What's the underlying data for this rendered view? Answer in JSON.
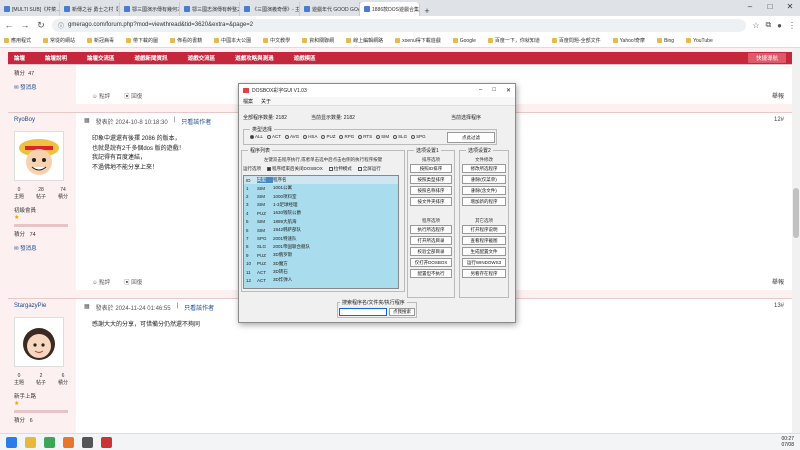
{
  "browser": {
    "tabs": [
      {
        "label": "[MULTI SUB]《芹菜…畢竟歡迎"
      },
      {
        "label": "新傳之谷 勇士之村【藍圖更新】"
      },
      {
        "label": "鄂三國演示傳有幾何三國94拜…"
      },
      {
        "label": "鄂三國志演傳有幹整之戰_固定"
      },
      {
        "label": "《三國演義奇傳》- 主題動畫("
      },
      {
        "label": "遊戲年代 GOOD GOAL - 遊戲 遊戲"
      },
      {
        "label": "1886款DOS遊戲合集-遊戲年代…"
      }
    ],
    "active_tab": 6,
    "url": "gmerago.com/forum.php?mod=viewthread&tid=3620&extra=&page=2"
  },
  "bookmarks": [
    "應用程式",
    "常從的網站",
    "新冠病毒",
    "帶下載的圖",
    "佈看的書籍",
    "中國本大公園",
    "中文教學",
    "資和關聯網",
    "線上編輯網路",
    "xoenu得下載遊戲",
    "Google",
    "百度一下，你就知道",
    "百度問題-全部文件",
    "Yahoo!奇摩",
    "Bing",
    "YouTube"
  ],
  "forum": {
    "nav": [
      "論壇",
      "論壇說明",
      "論壇交流區",
      "遊戲新聞資訊",
      "遊戲交流區",
      "遊戲攻略與測過",
      "遊戲模區"
    ],
    "quick_nav": "快捷導航",
    "post0": {
      "label_points": "積分",
      "points": "47",
      "send_msg": "發消息",
      "like": "點評",
      "reply": "回復",
      "report": "舉報"
    },
    "post1": {
      "user": "RyoBoy",
      "meta": "發表於 2024-10-8 10:18:30",
      "author_only": "只看該作者",
      "floor": "12#",
      "lines": [
        "印象中還還有後擇 2086 的版本，",
        "也就是說有2千多個dos 版的遊戲！",
        "我記得有百度連結，",
        "不過佛地不能分享上來！"
      ],
      "stats": [
        {
          "n": "0",
          "l": "主題"
        },
        {
          "n": "28",
          "l": "帖子"
        },
        {
          "n": "74",
          "l": "積分"
        }
      ],
      "rank": "初級會員",
      "points_label": "積分",
      "points": "74",
      "send_msg": "發消息",
      "like": "點評",
      "reply": "回復",
      "report": "舉報"
    },
    "post2": {
      "user": "StargazyPie",
      "meta": "發表於 2024-11-24 01:46:55",
      "author_only": "只看該作者",
      "floor": "13#",
      "text": "感謝大大的分享，可惜備分仍然還不夠同",
      "stats": [
        {
          "n": "0",
          "l": "主題"
        },
        {
          "n": "2",
          "l": "帖子"
        },
        {
          "n": "6",
          "l": "積分"
        }
      ],
      "rank": "新手上路",
      "points_label": "積分",
      "points": "6"
    }
  },
  "app": {
    "title": "DOSBOX彩宇GUI V1.03",
    "menu": [
      "檔案",
      "关于"
    ],
    "total_label": "全部程序数量:",
    "total": "2182",
    "current_label": "当前显示数量:",
    "current": "2182",
    "selected_label": "当前选择程序",
    "type_group": "类型选择",
    "types": [
      "ALL",
      "ACT",
      "AVG",
      "HSA",
      "PUZ",
      "RPG",
      "RTS",
      "SIM",
      "SLG",
      "SPG"
    ],
    "selected_type": "ALL",
    "click_filter": "点此过滤",
    "list_group": "程序列表",
    "hint": "左键双击程序执行,或者单击选中后点击右侧的执行程序按键",
    "opt_label": "运行选项",
    "options": [
      {
        "label": "程序结束后关闭DOSBOX",
        "on": true
      },
      {
        "label": "拉伸模式",
        "on": false
      },
      {
        "label": "全屏运行",
        "on": false
      }
    ],
    "cols": [
      "ID",
      "类型",
      "程序名"
    ],
    "rows": [
      [
        "1",
        "SIM",
        "1001公寓"
      ],
      [
        "2",
        "SIM",
        "1000项料室"
      ],
      [
        "3",
        "SIM",
        "1-3足球经理"
      ],
      [
        "4",
        "PUZ",
        "1630钱院公爵"
      ],
      [
        "5",
        "SIM",
        "1889大航海"
      ],
      [
        "6",
        "SIM",
        "1942韩萨部队"
      ],
      [
        "7",
        "SPG",
        "2001特速队"
      ],
      [
        "8",
        "SLG",
        "2001帝国联合舰队"
      ],
      [
        "9",
        "PUZ",
        "3D俄罗斯"
      ],
      [
        "10",
        "PUZ",
        "3D魔方"
      ],
      [
        "11",
        "ACT",
        "3D转石"
      ],
      [
        "12",
        "ACT",
        "3D炸弹人"
      ]
    ],
    "set1": "选项设置1",
    "sort_label": "排序选项",
    "sort_btns": [
      "按照ID排序",
      "按照类型排序",
      "按照名称排序",
      "按文件夹排序"
    ],
    "prog_label": "程序选项",
    "prog_btns": [
      "执行所选程序",
      "打开所选目录",
      "校验全部目录",
      "仅打开DOSBOX",
      "配置但不执行"
    ],
    "set2": "选项设置2",
    "file_label": "文件修改",
    "file_btns": [
      "修改所选程序",
      "删除(仅菜单)",
      "删除(含文件)",
      "增加新的程序"
    ],
    "other_label": "其它选项",
    "other_btns": [
      "打开程序说明",
      "查看程序截图",
      "生成配置文件",
      "运行WINDOWS3",
      "另看存在程序"
    ],
    "search_label": "搜索程序名/文件夹/执行程序",
    "search_btn": "点我搜索"
  },
  "clock": {
    "time": "00:27",
    "date": "07/08"
  }
}
